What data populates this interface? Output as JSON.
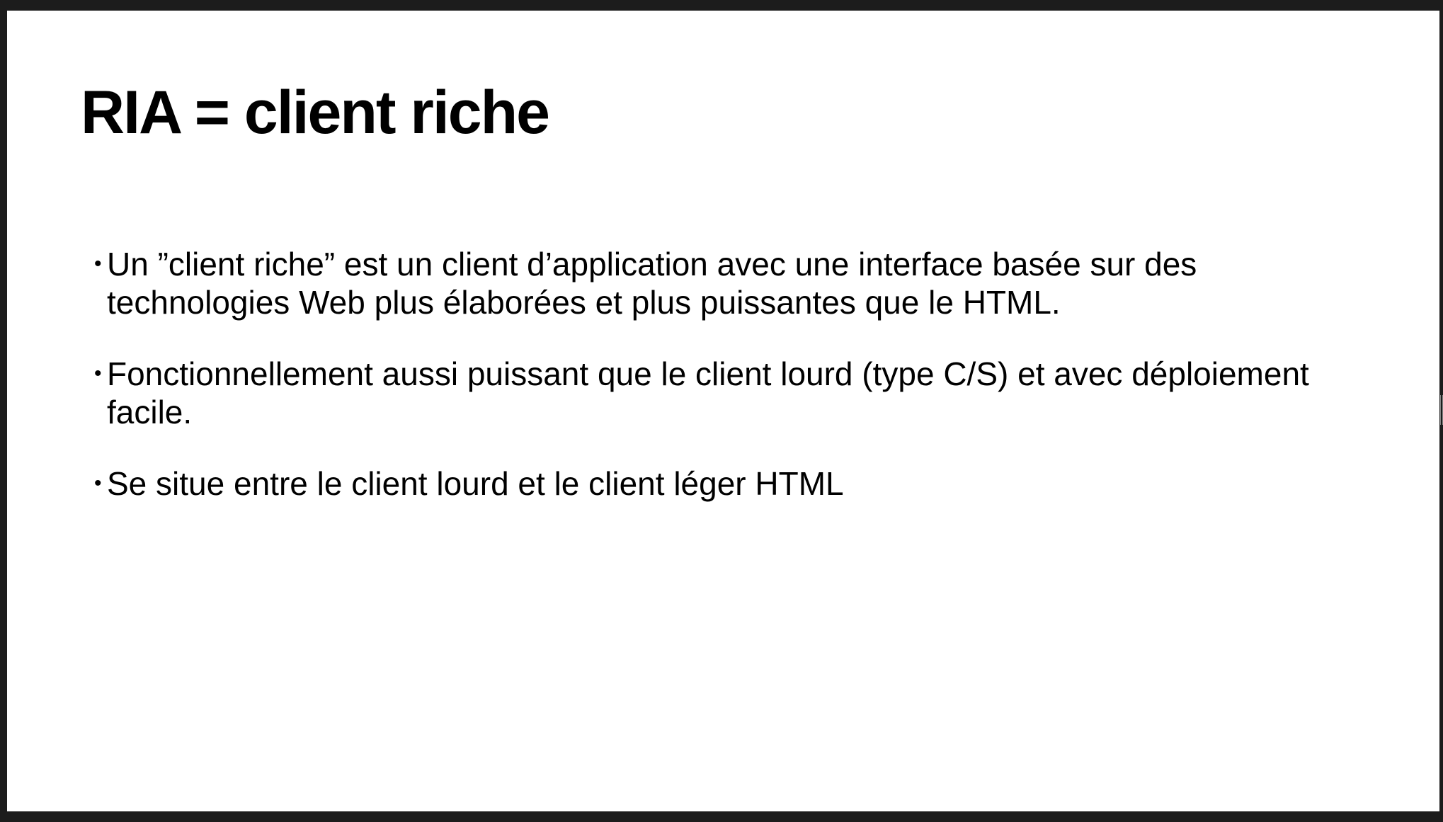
{
  "slide": {
    "title": "RIA = client riche",
    "bullet_symbol": "•",
    "bullets": [
      "Un ”client riche” est un client d’application avec une interface basée sur des technologies Web plus élaborées et plus puissantes que le HTML.",
      "Fonctionnellement aussi puissant que le client lourd (type C/S) et avec déploiement facile.",
      "Se situe entre le client lourd et le client léger HTML"
    ]
  },
  "colors": {
    "frame": "#1c1c1c",
    "slide_background": "#ffffff",
    "text": "#000000"
  }
}
